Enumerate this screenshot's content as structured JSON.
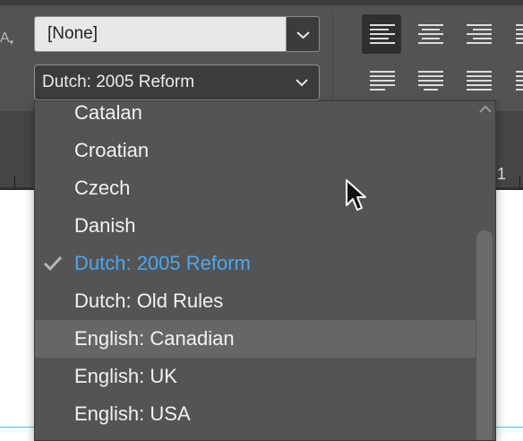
{
  "control_panel": {
    "paragraph_style": {
      "value": "[None]"
    },
    "language_select": {
      "value": "Dutch: 2005 Reform"
    }
  },
  "language_menu": {
    "items": [
      {
        "label": "Catalan"
      },
      {
        "label": "Croatian"
      },
      {
        "label": "Czech"
      },
      {
        "label": "Danish"
      },
      {
        "label": "Dutch: 2005 Reform",
        "checked": true
      },
      {
        "label": "Dutch: Old Rules"
      },
      {
        "label": "English: Canadian",
        "hovered": true
      },
      {
        "label": "English: UK"
      },
      {
        "label": "English: USA"
      }
    ]
  },
  "ruler": {
    "visible_number": "1"
  },
  "colors": {
    "checked_item": "#4aa8f0",
    "menu_background": "#545454",
    "hover_row": "#666666",
    "panel_background": "#535353",
    "guide_line": "#45c6e6"
  }
}
